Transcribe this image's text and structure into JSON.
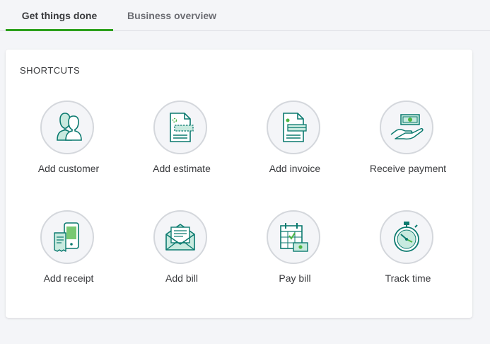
{
  "tabs": {
    "active": "Get things done",
    "inactive": "Business overview"
  },
  "shortcuts": {
    "title": "SHORTCUTS",
    "items": [
      {
        "label": "Add customer",
        "icon": "customer-icon"
      },
      {
        "label": "Add estimate",
        "icon": "estimate-icon"
      },
      {
        "label": "Add invoice",
        "icon": "invoice-icon"
      },
      {
        "label": "Receive payment",
        "icon": "payment-icon"
      },
      {
        "label": "Add receipt",
        "icon": "receipt-icon"
      },
      {
        "label": "Add bill",
        "icon": "bill-icon"
      },
      {
        "label": "Pay bill",
        "icon": "pay-bill-icon"
      },
      {
        "label": "Track time",
        "icon": "stopwatch-icon"
      }
    ]
  },
  "colors": {
    "accent": "#2ca01c",
    "icon_stroke": "#0b7a6f",
    "icon_fill": "#c8eadf",
    "money_green": "#4bb543"
  }
}
